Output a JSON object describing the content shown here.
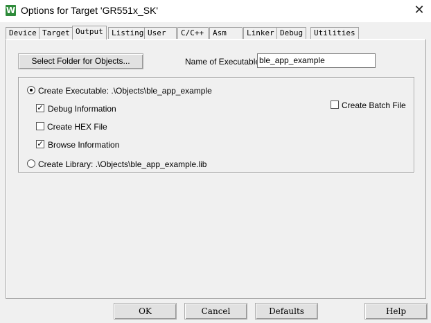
{
  "window": {
    "title": "Options for Target 'GR551x_SK'",
    "app_icon_glyph": "W",
    "close_glyph": "✕"
  },
  "tabs": [
    {
      "label": "Device",
      "active": false
    },
    {
      "label": "Target",
      "active": false
    },
    {
      "label": "Output",
      "active": true
    },
    {
      "label": "Listing",
      "active": false
    },
    {
      "label": "User",
      "active": false
    },
    {
      "label": "C/C++",
      "active": false
    },
    {
      "label": "Asm",
      "active": false
    },
    {
      "label": "Linker",
      "active": false
    },
    {
      "label": "Debug",
      "active": false
    },
    {
      "label": "Utilities",
      "active": false
    }
  ],
  "output": {
    "select_folder_label": "Select Folder for Objects...",
    "name_label": "Name of Executable:",
    "name_value": "ble_app_example",
    "create_executable_label": "Create Executable:  .\\Objects\\ble_app_example",
    "debug_info_label": "Debug Information",
    "create_hex_label": "Create HEX File",
    "browse_info_label": "Browse Information",
    "create_library_label": "Create Library:  .\\Objects\\ble_app_example.lib",
    "create_batch_label": "Create Batch File",
    "checked_mark": "✓"
  },
  "footer": {
    "ok": "OK",
    "cancel": "Cancel",
    "defaults": "Defaults",
    "help": "Help"
  },
  "colors": {
    "background": "#f0f0f0",
    "app_icon": "#2e8b3a"
  }
}
